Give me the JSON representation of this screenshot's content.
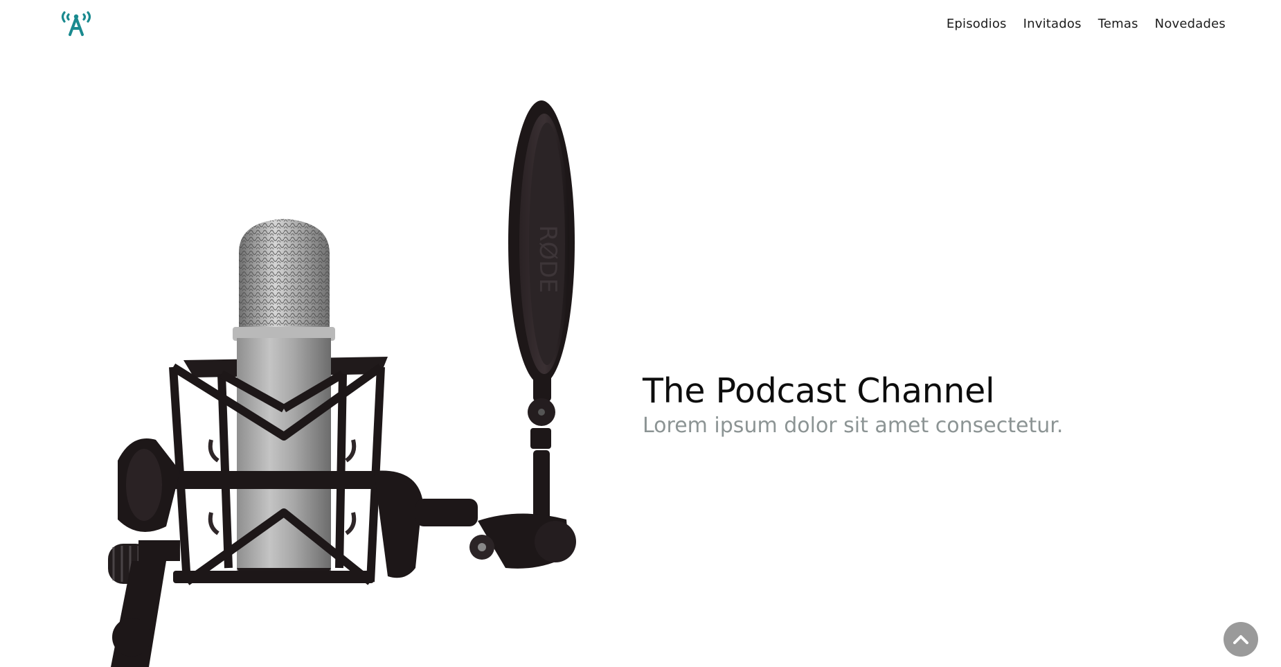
{
  "header": {
    "logo_icon": "broadcast-antenna-icon",
    "logo_color": "#1a8a8f",
    "nav": [
      {
        "label": "Episodios"
      },
      {
        "label": "Invitados"
      },
      {
        "label": "Temas"
      },
      {
        "label": "Novedades"
      }
    ]
  },
  "hero": {
    "image": "studio-microphone-with-pop-filter",
    "title": "The Podcast Channel",
    "subtitle": "Lorem ipsum dolor sit amet consectetur.",
    "title_color": "#0d0d0d",
    "subtitle_color": "#8c9494"
  },
  "scroll_top": {
    "icon": "chevron-up-icon",
    "color": "#9a9a9a"
  }
}
